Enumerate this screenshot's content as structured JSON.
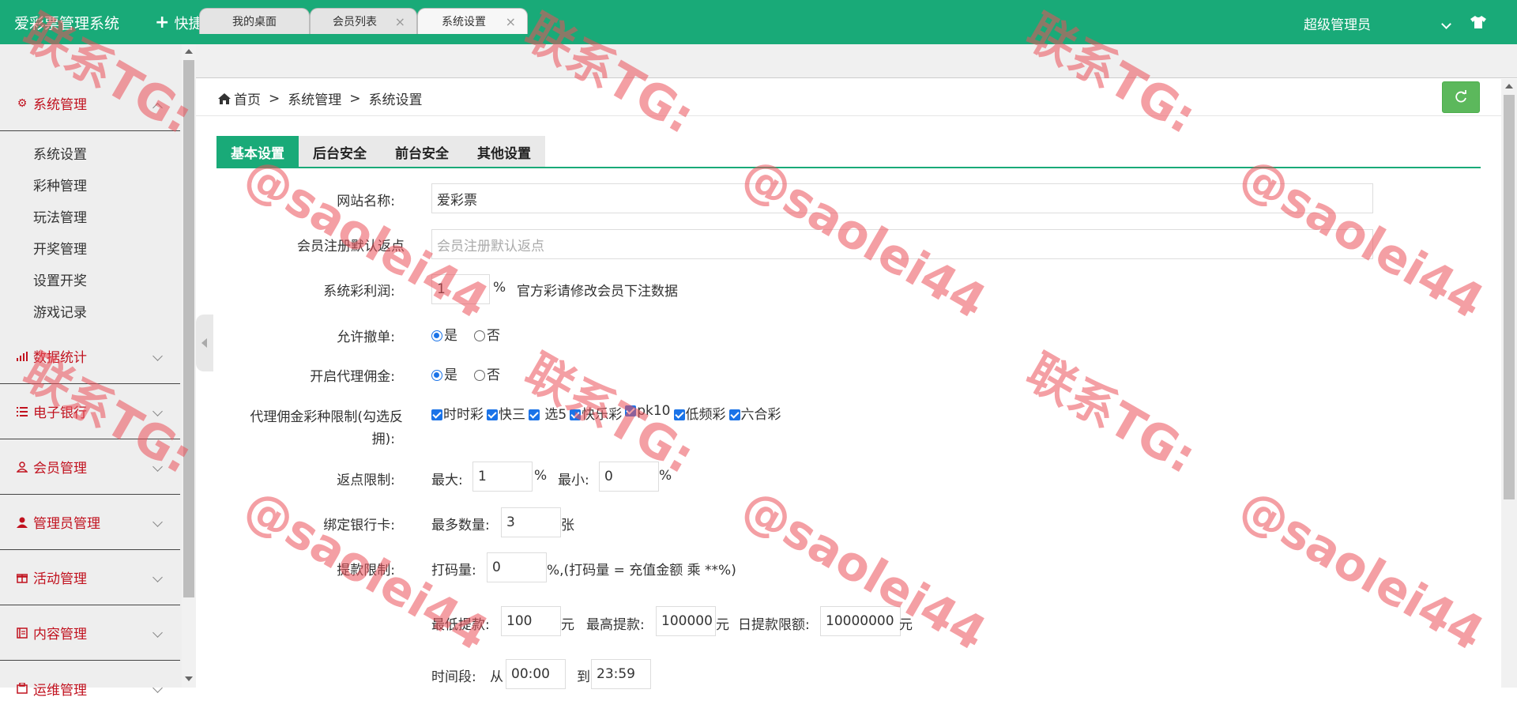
{
  "topbar": {
    "brand": "爱彩票管理系统",
    "quick_menu": "快捷菜单",
    "admin_name": "超级管理员"
  },
  "sidebar": {
    "groups": [
      {
        "label": "系统管理",
        "icon": "gear-icon",
        "expanded": true,
        "items": [
          "系统设置",
          "彩种管理",
          "玩法管理",
          "开奖管理",
          "设置开奖",
          "游戏记录"
        ]
      },
      {
        "label": "数据统计",
        "icon": "chart-icon"
      },
      {
        "label": "电子银行",
        "icon": "list-icon"
      },
      {
        "label": "会员管理",
        "icon": "user-icon"
      },
      {
        "label": "管理员管理",
        "icon": "admin-icon"
      },
      {
        "label": "活动管理",
        "icon": "gift-icon"
      },
      {
        "label": "内容管理",
        "icon": "book-icon"
      },
      {
        "label": "运维管理",
        "icon": "tool-icon"
      }
    ]
  },
  "page_tabs": [
    {
      "label": "我的桌面"
    },
    {
      "label": "会员列表",
      "close": "×"
    },
    {
      "label": "系统设置",
      "close": "×"
    }
  ],
  "breadcrumb": {
    "home": "首页",
    "sep": ">",
    "level1": "系统管理",
    "level2": "系统设置"
  },
  "settings_tabs": [
    "基本设置",
    "后台安全",
    "前台安全",
    "其他设置"
  ],
  "form": {
    "site_name_label": "网站名称:",
    "site_name_value": "爱彩票",
    "rebate_label": "会员注册默认返点",
    "rebate_placeholder": "会员注册默认返点",
    "profit_label": "系统彩利润:",
    "profit_value": "1",
    "profit_unit": "%",
    "profit_note": "官方彩请修改会员下注数据",
    "cancel_label": "允许撤单:",
    "yes": "是",
    "no": "否",
    "agent_label": "开启代理佣金:",
    "limit_label_1": "代理佣金彩种限制(勾选反",
    "limit_label_2": "拥):",
    "lottery_types": [
      "时时彩",
      "快三",
      " 选5",
      "快乐彩",
      "pk10",
      "低频彩",
      "六合彩"
    ],
    "rebate_limit_label": "返点限制:",
    "max_label": "最大:",
    "max_value": "1",
    "min_label": "最小:",
    "min_value": "0",
    "pct": "%",
    "bind_label": "绑定银行卡:",
    "max_count_label": "最多数量:",
    "max_count_value": "3",
    "card_unit": "张",
    "withdraw_label": "提款限制:",
    "code_label": "打码量:",
    "code_value": "0",
    "code_note": "%,(打码量 = 充值金额 乘 **%)",
    "min_withdraw_label": "最低提款:",
    "min_withdraw_value": "100",
    "yuan": "元",
    "max_withdraw_label": "最高提款:",
    "max_withdraw_value": "100000",
    "daily_label": "日提款限额:",
    "daily_value": "10000000",
    "time_label": "时间段:",
    "from_label": "从",
    "from_value": "00:00",
    "to_label": "到",
    "to_value": "23:59"
  },
  "watermark": {
    "line1": "联系TG:",
    "line2": "@saolei44"
  },
  "colors": {
    "primary": "#19aa78",
    "menu_text": "#c1121f",
    "refresh": "#5cb85c"
  }
}
